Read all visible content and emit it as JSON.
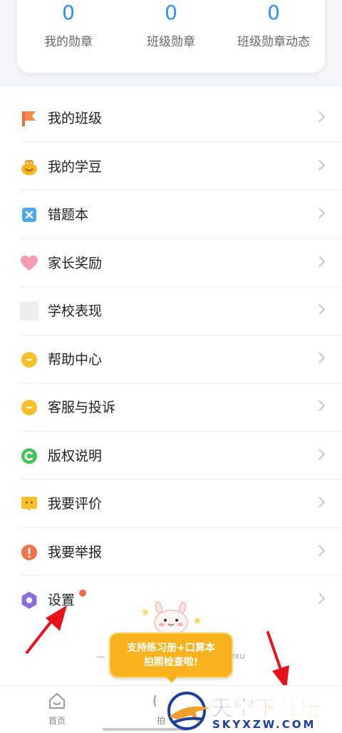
{
  "stats": [
    {
      "value": "0",
      "label": "我的勋章"
    },
    {
      "value": "0",
      "label": "班级勋章"
    },
    {
      "value": "0",
      "label": "班级勋章动态"
    }
  ],
  "menu": [
    {
      "label": "我的班级",
      "icon": "flag-icon",
      "color": "#f26b3a"
    },
    {
      "label": "我的学豆",
      "icon": "bean-icon",
      "color": "#f6b622"
    },
    {
      "label": "错题本",
      "icon": "wrong-notebook-icon",
      "color": "#4aa9ea"
    },
    {
      "label": "家长奖励",
      "icon": "heart-icon",
      "color": "#f49ab3"
    },
    {
      "label": "学校表现",
      "icon": "school-icon",
      "color": "#eeeeee"
    },
    {
      "label": "帮助中心",
      "icon": "help-icon",
      "color": "#f7c02b"
    },
    {
      "label": "客服与投诉",
      "icon": "service-icon",
      "color": "#f7c02b"
    },
    {
      "label": "版权说明",
      "icon": "copyright-icon",
      "color": "#46c45c"
    },
    {
      "label": "我要评价",
      "icon": "review-icon",
      "color": "#f7c02b"
    },
    {
      "label": "我要举报",
      "icon": "report-icon",
      "color": "#f0744a"
    },
    {
      "label": "设置",
      "icon": "settings-icon",
      "color": "#8a6ee0"
    }
  ],
  "footer": {
    "left": "一",
    "right": "exu"
  },
  "promo": {
    "line1": "支持练习册+口算本",
    "line2": "拍照检查啦!"
  },
  "tabbar": {
    "home_label": "首页",
    "camera_label": "拍"
  },
  "watermark": {
    "cn_part1": "天空",
    "cn_part2": "下载玩",
    "en": "SKYXZW.COM"
  },
  "colors": {
    "accent": "#2f8ff7",
    "annotation_arrow": "#e8121b"
  }
}
